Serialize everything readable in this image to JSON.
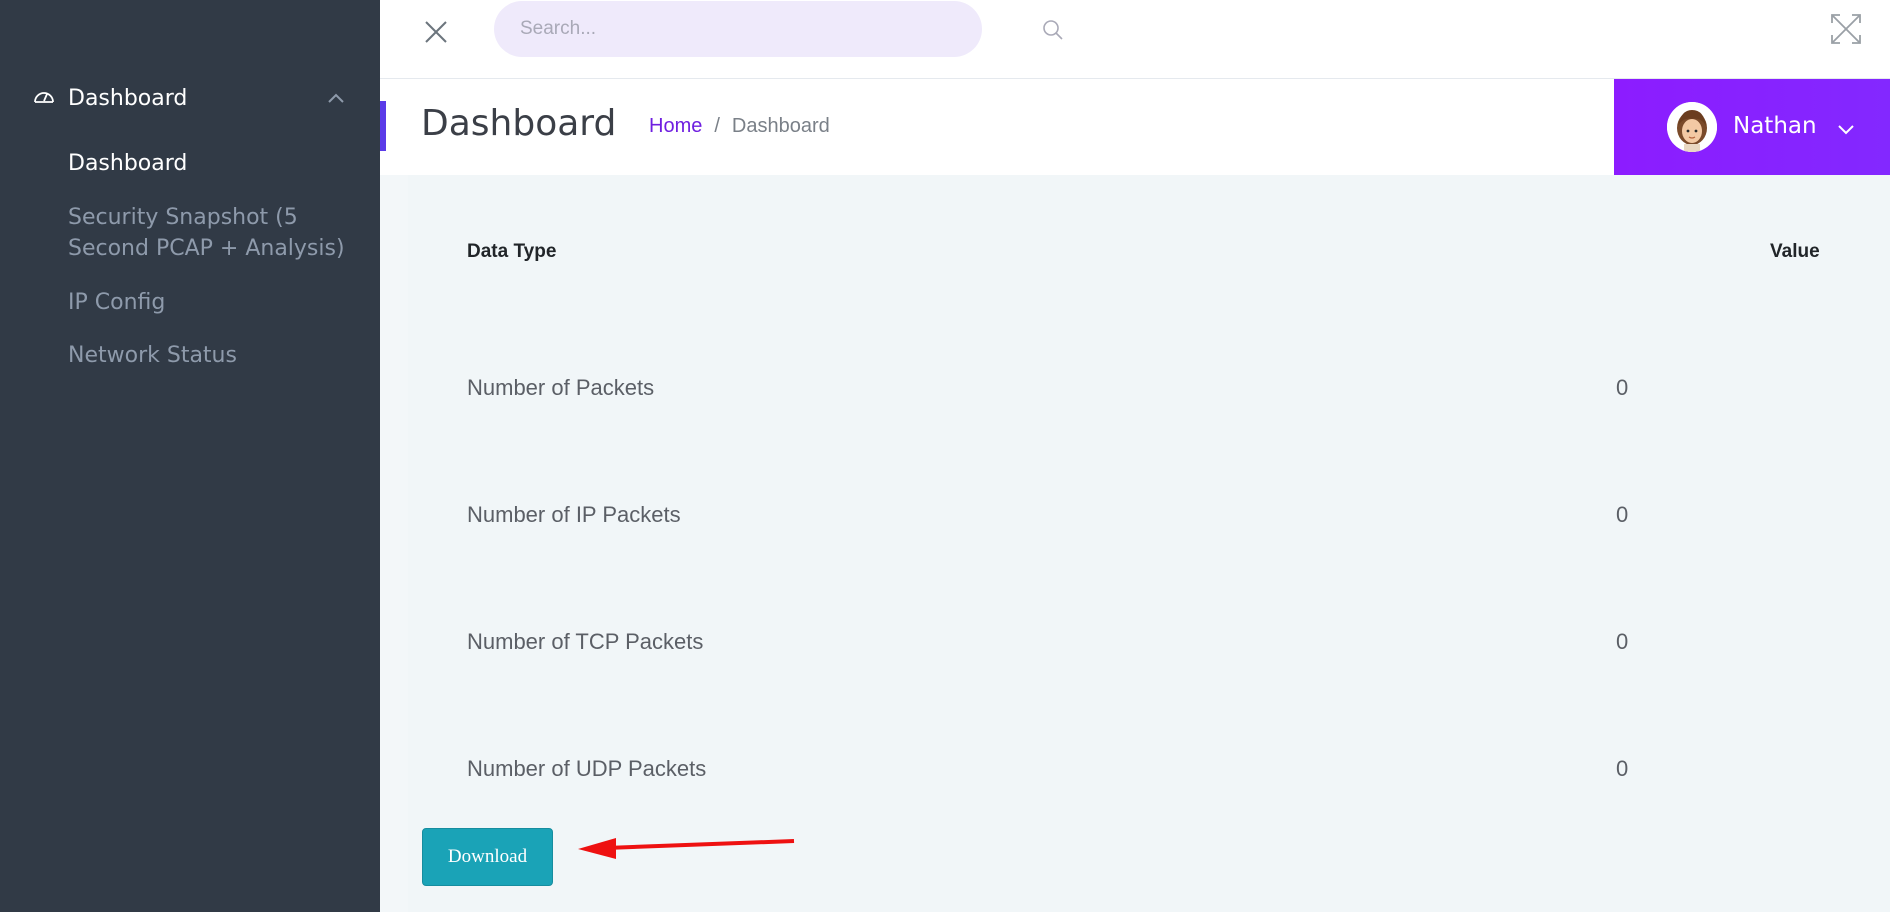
{
  "sidebar": {
    "group_label": "Dashboard",
    "items": [
      {
        "label": "Dashboard"
      },
      {
        "label": "Security Snapshot (5 Second PCAP + Analysis)"
      },
      {
        "label": "IP Config"
      },
      {
        "label": "Network Status"
      }
    ]
  },
  "topbar": {
    "search_placeholder": "Search..."
  },
  "header": {
    "title": "Dashboard",
    "breadcrumb": {
      "home": "Home",
      "separator": "/",
      "current": "Dashboard"
    }
  },
  "user": {
    "name": "Nathan"
  },
  "table": {
    "headers": {
      "type": "Data Type",
      "value": "Value"
    },
    "rows": [
      {
        "label": "Number of Packets",
        "value": "0"
      },
      {
        "label": "Number of IP Packets",
        "value": "0"
      },
      {
        "label": "Number of TCP Packets",
        "value": "0"
      },
      {
        "label": "Number of UDP Packets",
        "value": "0"
      }
    ]
  },
  "actions": {
    "download_label": "Download"
  },
  "colors": {
    "sidebar_bg": "#313a46",
    "accent_purple": "#8328ff",
    "button_teal": "#1aa3b7",
    "annotation_arrow": "#ee1111"
  },
  "icons": {
    "sidebar_group": "gauge-icon",
    "close": "close-icon",
    "search": "search-icon",
    "fullscreen": "expand-icon",
    "user_dropdown": "chevron-down-icon"
  }
}
